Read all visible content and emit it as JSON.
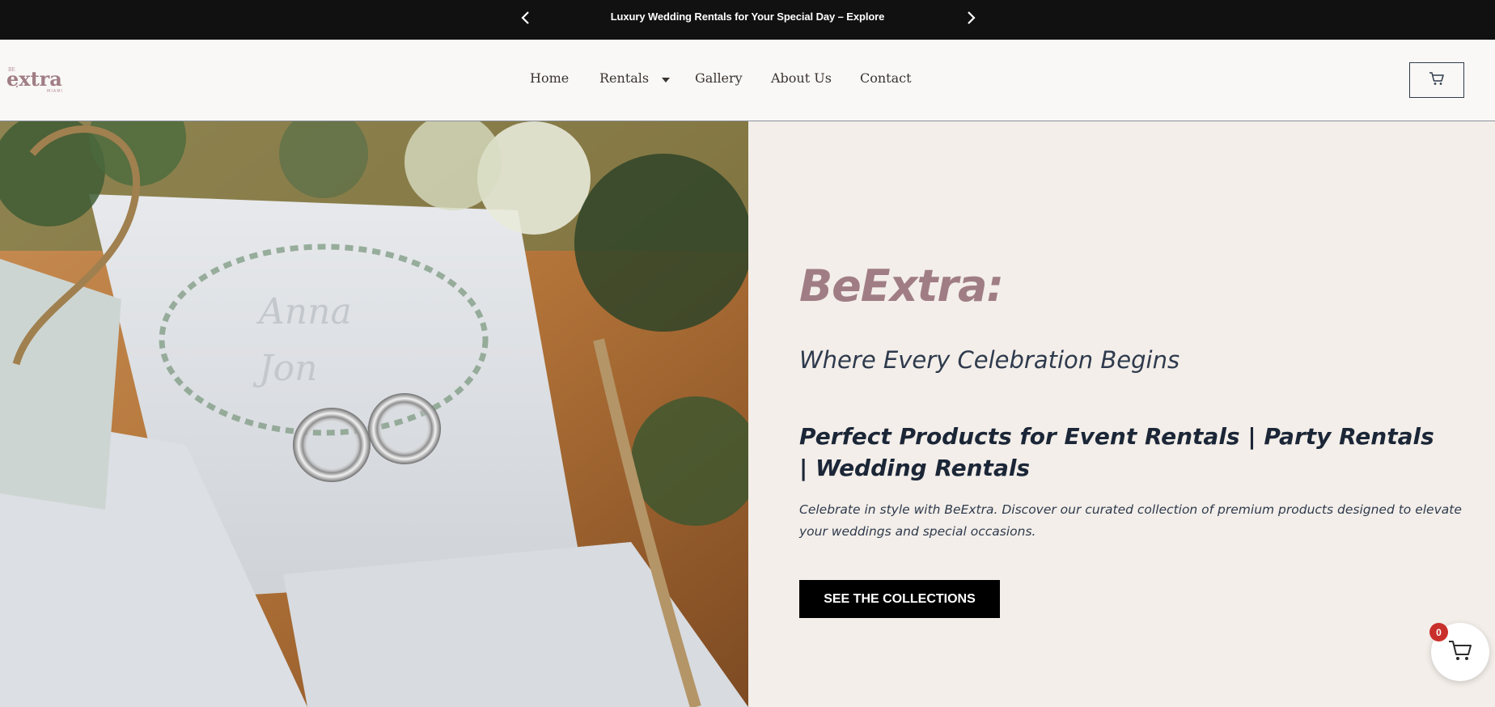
{
  "announcement": {
    "text": "Luxury Wedding Rentals for Your Special Day – Explore",
    "prev_icon": "chevron-left-icon",
    "next_icon": "chevron-right-icon"
  },
  "header": {
    "logo_text_small": "BE",
    "logo_text": "extra",
    "logo_subtext": "MIAMI",
    "nav": [
      {
        "label": "Home"
      },
      {
        "label": "Rentals",
        "icon": "caret-down-icon"
      },
      {
        "label": "Gallery"
      },
      {
        "label": "About Us"
      },
      {
        "label": "Contact"
      }
    ],
    "cart_icon": "cart-icon"
  },
  "hero": {
    "title": "BeExtra:",
    "subtitle": "Where Every Celebration Begins",
    "heading": "Perfect Products for Event Rentals | Party Rentals | Wedding Rentals",
    "description": "Celebrate in style with BeExtra. Discover our curated collection of premium products designed to elevate your weddings and special occasions.",
    "cta_label": "SEE THE COLLECTIONS",
    "image": "wedding-rings-on-invitation-photo"
  },
  "floating_cart": {
    "count": "0",
    "icon": "cart-icon"
  },
  "colors": {
    "accent": "#a07d84",
    "dark": "#111111",
    "panel": "#f3eee9",
    "badge": "#c9302c"
  }
}
